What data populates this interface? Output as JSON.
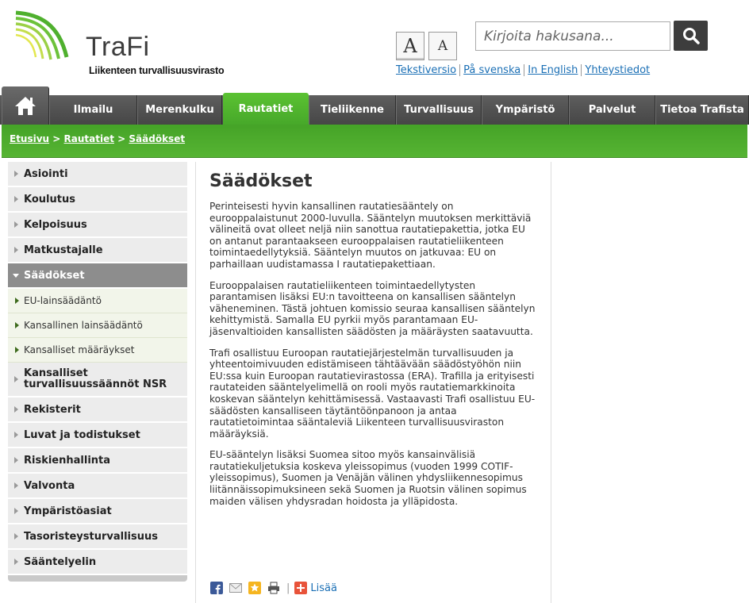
{
  "header": {
    "logo_name": "TraFi",
    "logo_subtitle": "Liikenteen turvallisuusvirasto",
    "font_large": "A",
    "font_small": "A",
    "search_placeholder": "Kirjoita hakusana...",
    "links": [
      "Tekstiversio",
      "På svenska",
      "In English",
      "Yhteystiedot"
    ]
  },
  "nav": {
    "tabs": [
      "Ilmailu",
      "Merenkulku",
      "Rautatiet",
      "Tieliikenne",
      "Turvallisuus",
      "Ympäristö",
      "Palvelut",
      "Tietoa Trafista"
    ],
    "active_tab": "Rautatiet"
  },
  "breadcrumb": [
    "Etusivu",
    "Rautatiet",
    "Säädökset"
  ],
  "sidebar": {
    "items": [
      "Asiointi",
      "Koulutus",
      "Kelpoisuus",
      "Matkustajalle",
      "Säädökset",
      "Kansalliset turvallisuussäännöt NSR",
      "Rekisterit",
      "Luvat ja todistukset",
      "Riskienhallinta",
      "Valvonta",
      "Ympäristöasiat",
      "Tasoristeysturvallisuus",
      "Sääntelyelin"
    ],
    "subitems": [
      "EU-lainsäädäntö",
      "Kansallinen lainsäädäntö",
      "Kansalliset määräykset"
    ]
  },
  "content": {
    "title": "Säädökset",
    "paragraphs": [
      "Perinteisesti hyvin kansallinen rautatiesääntely on eurooppalaistunut 2000-luvulla. Sääntelyn muutoksen merkittäviä välineitä ovat olleet neljä niin sanottua rautatiepakettia, jotka EU on antanut parantaakseen eurooppalaisen rautatieliikenteen toimintaedellytyksiä. Sääntelyn muutos on jatkuvaa: EU on parhaillaan uudistamassa I rautatiepakettiaan.",
      "Eurooppalaisen rautatieliikenteen toimintaedellytysten parantamisen lisäksi EU:n tavoitteena on kansallisen sääntelyn väheneminen. Tästä johtuen komissio seuraa kansallisen sääntelyn kehittymistä. Samalla EU pyrkii myös parantamaan EU-jäsenvaltioiden kansallisten säädösten ja määräysten saatavuutta.",
      "Trafi osallistuu Euroopan rautatiejärjestelmän turvallisuuden ja yhteentoimivuuden edistämiseen tähtäävään säädöstyöhön niin EU:ssa kuin Euroopan rautatievirastossa (ERA). Trafilla ja erityisesti rautateiden sääntelyelimellä on rooli myös rautatiemarkkinoita koskevan sääntelyn kehittämisessä. Vastaavasti Trafi osallistuu EU-säädösten kansalliseen täytäntöönpanoon ja antaa rautatietoimintaa sääntaleviä Liikenteen turvallisuusviraston määräyksiä.",
      "EU-sääntelyn lisäksi Suomea sitoo myös kansainvälisiä rautatiekuljetuksia koskeva yleissopimus (vuoden 1999 COTIF-yleissopimus), Suomen ja Venäjän välinen yhdysliikennesopimus liitännäissopimuksineen sekä Suomen ja Ruotsin välinen sopimus maiden välisen yhdysradan hoidosta ja ylläpidosta."
    ]
  },
  "share": {
    "separator": "|",
    "more_label": "Lisää"
  },
  "colors": {
    "green": "#4fb02e",
    "nav_dark": "#4f4f4f",
    "link": "#1a6fb5"
  }
}
